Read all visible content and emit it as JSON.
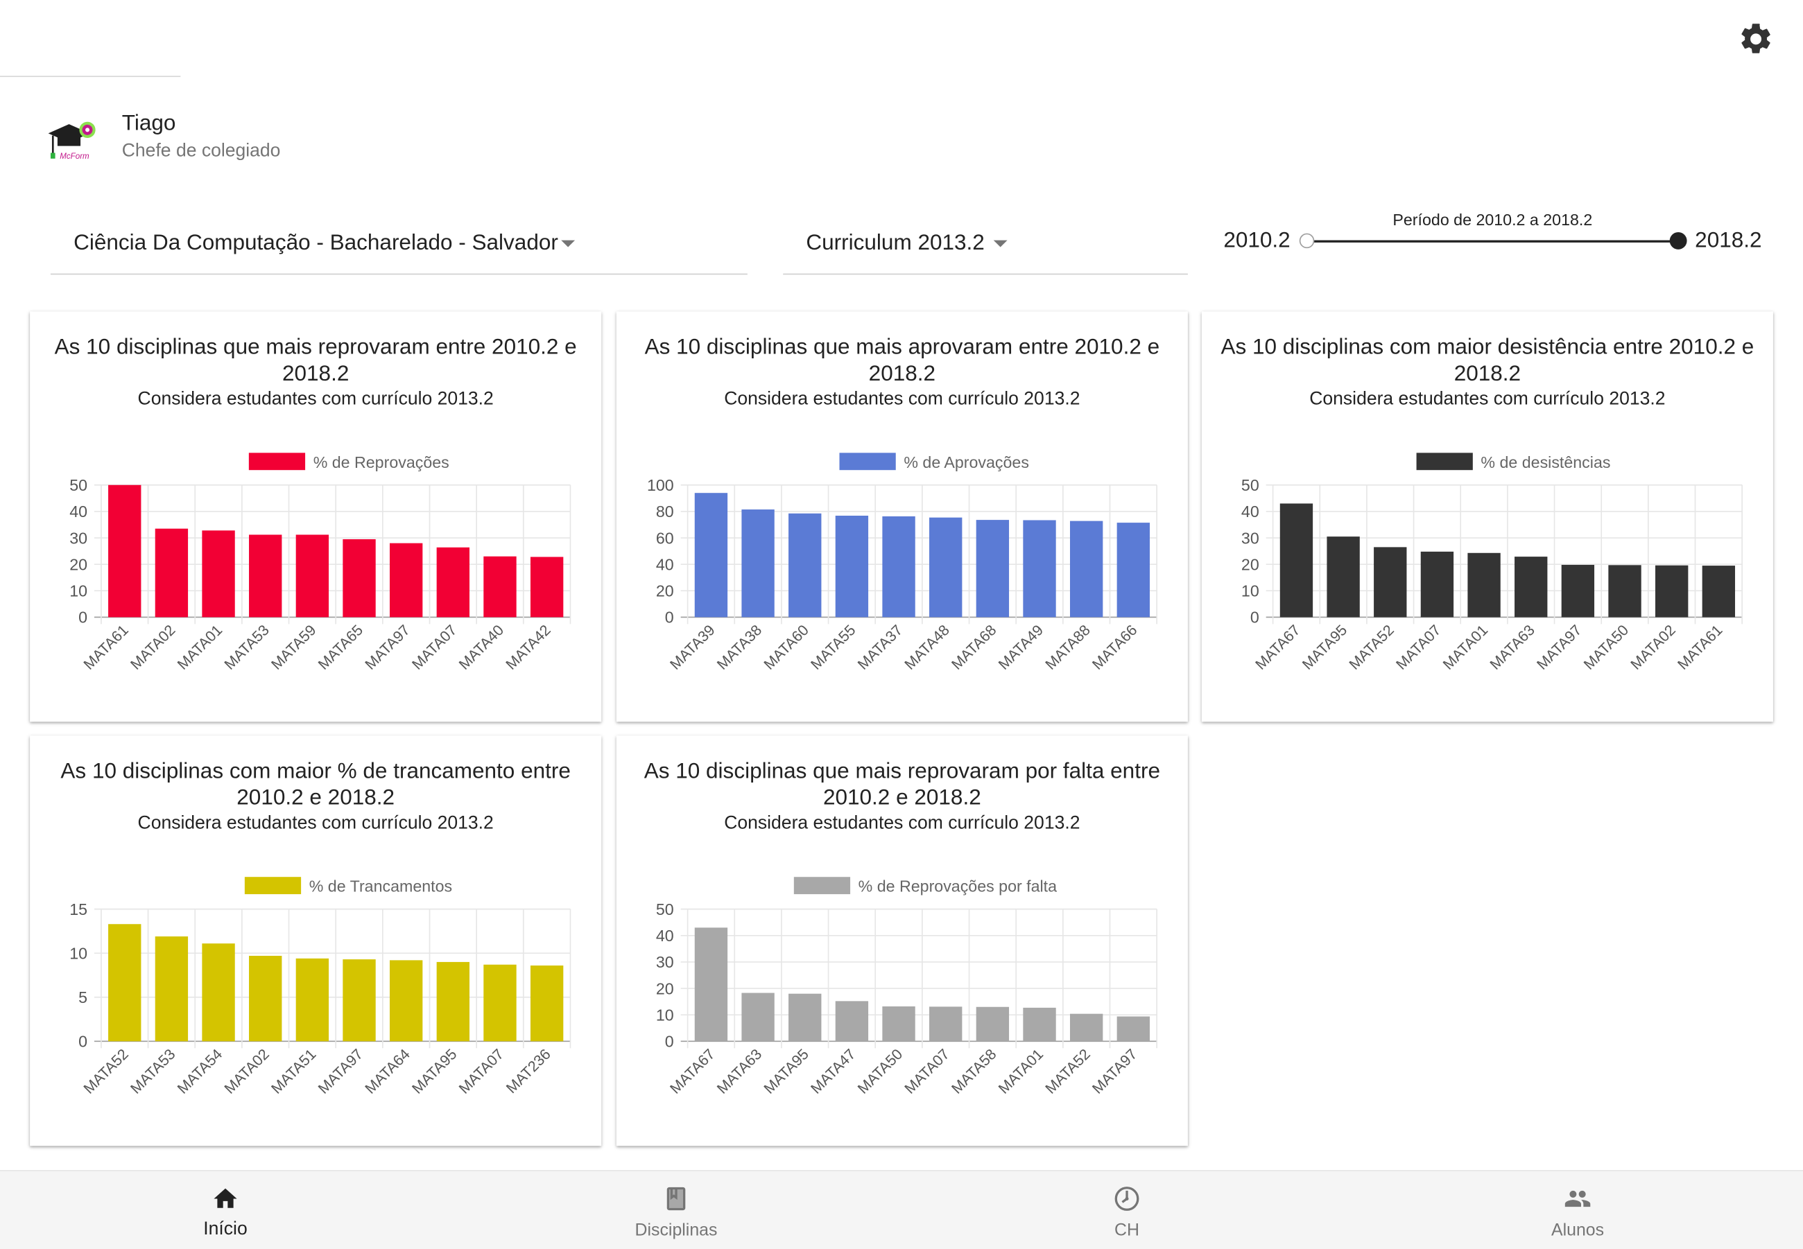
{
  "header": {
    "settings_icon": "gear-icon"
  },
  "user": {
    "name": "Tiago",
    "role": "Chefe de colegiado",
    "logo_icon": "graduation-cap-logo-icon"
  },
  "filters": {
    "course": "Ciência Da Computação - Bacharelado - Salvador",
    "curriculum": "Curriculum 2013.2",
    "period_title": "Período de 2010.2 a 2018.2",
    "period_start": "2010.2",
    "period_end": "2018.2"
  },
  "cards": [
    {
      "title": "As 10 disciplinas que mais reprovaram entre 2010.2 e 2018.2",
      "subtitle": "Considera estudantes com currículo 2013.2"
    },
    {
      "title": "As 10 disciplinas que mais aprovaram entre 2010.2 e 2018.2",
      "subtitle": "Considera estudantes com currículo 2013.2"
    },
    {
      "title": "As 10 disciplinas com maior desistência entre 2010.2 e 2018.2",
      "subtitle": "Considera estudantes com currículo 2013.2"
    },
    {
      "title": "As 10 disciplinas com maior % de trancamento entre 2010.2 e 2018.2",
      "subtitle": "Considera estudantes com currículo 2013.2"
    },
    {
      "title": "As 10 disciplinas que mais reprovaram por falta entre 2010.2 e 2018.2",
      "subtitle": "Considera estudantes com currículo 2013.2"
    }
  ],
  "chart_data": [
    {
      "type": "bar",
      "categories": [
        "MATA61",
        "MATA02",
        "MATA01",
        "MATA53",
        "MATA59",
        "MATA65",
        "MATA97",
        "MATA07",
        "MATA40",
        "MATA42"
      ],
      "series": [
        {
          "name": "% de Reprovações",
          "values": [
            50,
            33.5,
            32.8,
            31.2,
            31.2,
            29.5,
            28,
            26.4,
            23,
            22.8
          ]
        }
      ],
      "ylim": [
        0,
        50
      ],
      "yticks": [
        0,
        10,
        20,
        30,
        40,
        50
      ],
      "color": "#f20034",
      "legend": "top",
      "grid": true
    },
    {
      "type": "bar",
      "categories": [
        "MATA39",
        "MATA38",
        "MATA60",
        "MATA55",
        "MATA37",
        "MATA48",
        "MATA68",
        "MATA49",
        "MATA88",
        "MATA66"
      ],
      "series": [
        {
          "name": "% de Aprovações",
          "values": [
            94,
            81.5,
            78.5,
            76.8,
            76.3,
            75.4,
            73.6,
            73.4,
            72.8,
            71.5
          ]
        }
      ],
      "ylim": [
        0,
        100
      ],
      "yticks": [
        0,
        20,
        40,
        60,
        80,
        100
      ],
      "color": "#5b7bd5",
      "legend": "top",
      "grid": true
    },
    {
      "type": "bar",
      "categories": [
        "MATA67",
        "MATA95",
        "MATA52",
        "MATA07",
        "MATA01",
        "MATA63",
        "MATA97",
        "MATA50",
        "MATA02",
        "MATA61"
      ],
      "series": [
        {
          "name": "% de desistências",
          "values": [
            43,
            30.5,
            26.5,
            24.8,
            24.3,
            22.9,
            19.8,
            19.7,
            19.6,
            19.5
          ]
        }
      ],
      "ylim": [
        0,
        50
      ],
      "yticks": [
        0,
        10,
        20,
        30,
        40,
        50
      ],
      "color": "#343434",
      "legend": "top",
      "grid": true
    },
    {
      "type": "bar",
      "categories": [
        "MATA52",
        "MATA53",
        "MATA54",
        "MATA02",
        "MATA51",
        "MATA97",
        "MATA64",
        "MATA95",
        "MATA07",
        "MAT236"
      ],
      "series": [
        {
          "name": "% de Trancamentos",
          "values": [
            13.3,
            11.9,
            11.1,
            9.7,
            9.4,
            9.3,
            9.2,
            9.0,
            8.7,
            8.6
          ]
        }
      ],
      "ylim": [
        0,
        15
      ],
      "yticks": [
        0,
        5,
        10,
        15
      ],
      "color": "#d4c400",
      "legend": "top",
      "grid": true
    },
    {
      "type": "bar",
      "categories": [
        "MATA67",
        "MATA63",
        "MATA95",
        "MATA47",
        "MATA50",
        "MATA07",
        "MATA58",
        "MATA01",
        "MATA52",
        "MATA97"
      ],
      "series": [
        {
          "name": "% de Reprovações por falta",
          "values": [
            43,
            18.3,
            18,
            15.2,
            13.2,
            13.1,
            13,
            12.7,
            10.4,
            9.4
          ]
        }
      ],
      "ylim": [
        0,
        50
      ],
      "yticks": [
        0,
        10,
        20,
        30,
        40,
        50
      ],
      "color": "#a8a8a8",
      "legend": "top",
      "grid": true
    }
  ],
  "bottom_nav": [
    {
      "label": "Início",
      "icon": "home-icon",
      "active": true
    },
    {
      "label": "Disciplinas",
      "icon": "book-icon",
      "active": false
    },
    {
      "label": "CH",
      "icon": "timer-icon",
      "active": false
    },
    {
      "label": "Alunos",
      "icon": "people-icon",
      "active": false
    }
  ]
}
